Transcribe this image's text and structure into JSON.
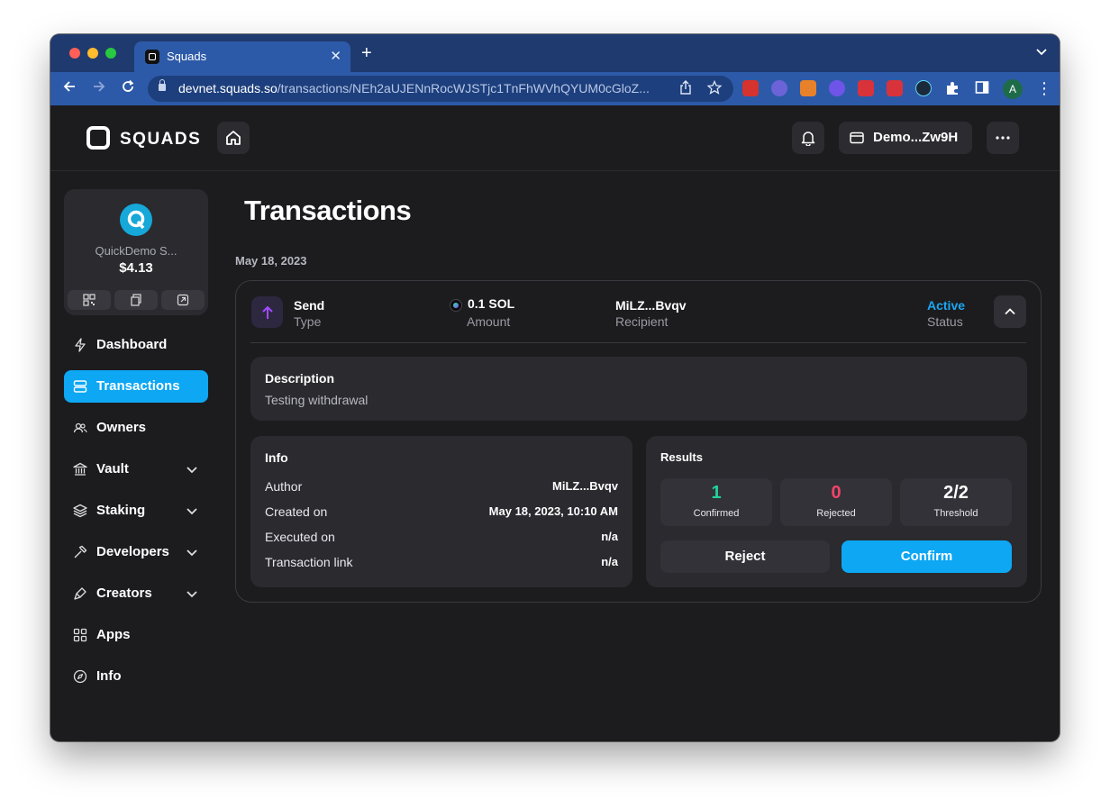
{
  "browser": {
    "tab_title": "Squads",
    "url_host": "devnet.squads.so",
    "url_path": "/transactions/NEh2aUJENnRocWJSTjc1TnFhWVhQYUM0cGloZ...",
    "avatar_initial": "A"
  },
  "header": {
    "logo_text": "SQUADS",
    "wallet_label": "Demo...Zw9H"
  },
  "sidebar": {
    "vault": {
      "name": "QuickDemo S...",
      "balance": "$4.13",
      "avatar_letter": "Q"
    },
    "items": [
      {
        "label": "Dashboard",
        "icon": "lightning-icon"
      },
      {
        "label": "Transactions",
        "icon": "stack-icon",
        "active": true
      },
      {
        "label": "Owners",
        "icon": "users-icon"
      },
      {
        "label": "Vault",
        "icon": "bank-icon",
        "expandable": true
      },
      {
        "label": "Staking",
        "icon": "layers-icon",
        "expandable": true
      },
      {
        "label": "Developers",
        "icon": "hammer-icon",
        "expandable": true
      },
      {
        "label": "Creators",
        "icon": "brush-icon",
        "expandable": true
      },
      {
        "label": "Apps",
        "icon": "grid-icon"
      },
      {
        "label": "Info",
        "icon": "compass-icon"
      }
    ]
  },
  "main": {
    "title": "Transactions",
    "date": "May 18, 2023",
    "transaction": {
      "type_value": "Send",
      "type_label": "Type",
      "amount_value": "0.1 SOL",
      "amount_label": "Amount",
      "recipient_value": "MiLZ...Bvqv",
      "recipient_label": "Recipient",
      "status_value": "Active",
      "status_label": "Status",
      "description_heading": "Description",
      "description_text": "Testing withdrawal",
      "info": {
        "heading": "Info",
        "rows": [
          {
            "label": "Author",
            "value": "MiLZ...Bvqv"
          },
          {
            "label": "Created on",
            "value": "May 18, 2023, 10:10 AM"
          },
          {
            "label": "Executed on",
            "value": "n/a"
          },
          {
            "label": "Transaction link",
            "value": "n/a"
          }
        ]
      },
      "results": {
        "heading": "Results",
        "confirmed_value": "1",
        "confirmed_label": "Confirmed",
        "rejected_value": "0",
        "rejected_label": "Rejected",
        "threshold_value": "2/2",
        "threshold_label": "Threshold",
        "reject_label": "Reject",
        "confirm_label": "Confirm"
      }
    }
  },
  "colors": {
    "accent": "#0da7f4",
    "status_active": "#1aa7f2",
    "confirmed": "#22d39a",
    "rejected": "#f0456a",
    "threshold": "#ffffff"
  }
}
